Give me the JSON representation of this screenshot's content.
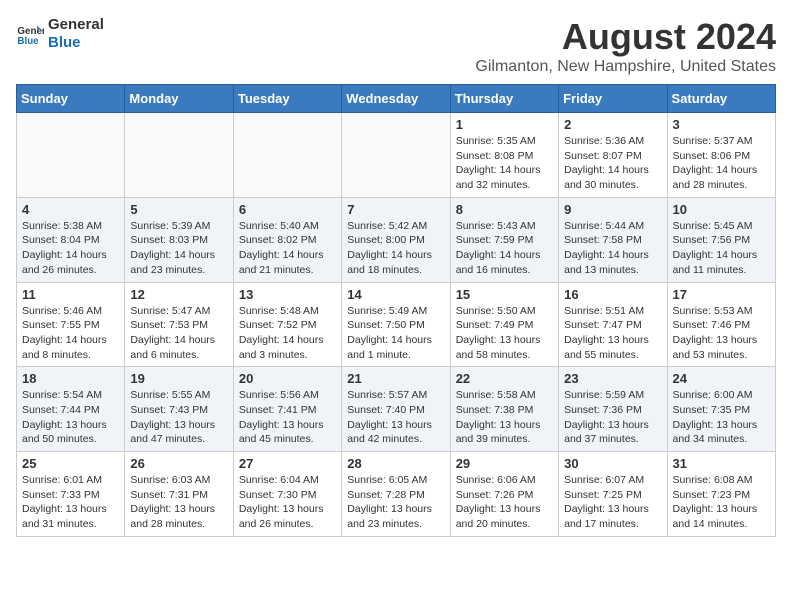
{
  "header": {
    "logo_line1": "General",
    "logo_line2": "Blue",
    "title": "August 2024",
    "subtitle": "Gilmanton, New Hampshire, United States"
  },
  "days_of_week": [
    "Sunday",
    "Monday",
    "Tuesday",
    "Wednesday",
    "Thursday",
    "Friday",
    "Saturday"
  ],
  "weeks": [
    [
      {
        "day": "",
        "info": ""
      },
      {
        "day": "",
        "info": ""
      },
      {
        "day": "",
        "info": ""
      },
      {
        "day": "",
        "info": ""
      },
      {
        "day": "1",
        "info": "Sunrise: 5:35 AM\nSunset: 8:08 PM\nDaylight: 14 hours\nand 32 minutes."
      },
      {
        "day": "2",
        "info": "Sunrise: 5:36 AM\nSunset: 8:07 PM\nDaylight: 14 hours\nand 30 minutes."
      },
      {
        "day": "3",
        "info": "Sunrise: 5:37 AM\nSunset: 8:06 PM\nDaylight: 14 hours\nand 28 minutes."
      }
    ],
    [
      {
        "day": "4",
        "info": "Sunrise: 5:38 AM\nSunset: 8:04 PM\nDaylight: 14 hours\nand 26 minutes."
      },
      {
        "day": "5",
        "info": "Sunrise: 5:39 AM\nSunset: 8:03 PM\nDaylight: 14 hours\nand 23 minutes."
      },
      {
        "day": "6",
        "info": "Sunrise: 5:40 AM\nSunset: 8:02 PM\nDaylight: 14 hours\nand 21 minutes."
      },
      {
        "day": "7",
        "info": "Sunrise: 5:42 AM\nSunset: 8:00 PM\nDaylight: 14 hours\nand 18 minutes."
      },
      {
        "day": "8",
        "info": "Sunrise: 5:43 AM\nSunset: 7:59 PM\nDaylight: 14 hours\nand 16 minutes."
      },
      {
        "day": "9",
        "info": "Sunrise: 5:44 AM\nSunset: 7:58 PM\nDaylight: 14 hours\nand 13 minutes."
      },
      {
        "day": "10",
        "info": "Sunrise: 5:45 AM\nSunset: 7:56 PM\nDaylight: 14 hours\nand 11 minutes."
      }
    ],
    [
      {
        "day": "11",
        "info": "Sunrise: 5:46 AM\nSunset: 7:55 PM\nDaylight: 14 hours\nand 8 minutes."
      },
      {
        "day": "12",
        "info": "Sunrise: 5:47 AM\nSunset: 7:53 PM\nDaylight: 14 hours\nand 6 minutes."
      },
      {
        "day": "13",
        "info": "Sunrise: 5:48 AM\nSunset: 7:52 PM\nDaylight: 14 hours\nand 3 minutes."
      },
      {
        "day": "14",
        "info": "Sunrise: 5:49 AM\nSunset: 7:50 PM\nDaylight: 14 hours\nand 1 minute."
      },
      {
        "day": "15",
        "info": "Sunrise: 5:50 AM\nSunset: 7:49 PM\nDaylight: 13 hours\nand 58 minutes."
      },
      {
        "day": "16",
        "info": "Sunrise: 5:51 AM\nSunset: 7:47 PM\nDaylight: 13 hours\nand 55 minutes."
      },
      {
        "day": "17",
        "info": "Sunrise: 5:53 AM\nSunset: 7:46 PM\nDaylight: 13 hours\nand 53 minutes."
      }
    ],
    [
      {
        "day": "18",
        "info": "Sunrise: 5:54 AM\nSunset: 7:44 PM\nDaylight: 13 hours\nand 50 minutes."
      },
      {
        "day": "19",
        "info": "Sunrise: 5:55 AM\nSunset: 7:43 PM\nDaylight: 13 hours\nand 47 minutes."
      },
      {
        "day": "20",
        "info": "Sunrise: 5:56 AM\nSunset: 7:41 PM\nDaylight: 13 hours\nand 45 minutes."
      },
      {
        "day": "21",
        "info": "Sunrise: 5:57 AM\nSunset: 7:40 PM\nDaylight: 13 hours\nand 42 minutes."
      },
      {
        "day": "22",
        "info": "Sunrise: 5:58 AM\nSunset: 7:38 PM\nDaylight: 13 hours\nand 39 minutes."
      },
      {
        "day": "23",
        "info": "Sunrise: 5:59 AM\nSunset: 7:36 PM\nDaylight: 13 hours\nand 37 minutes."
      },
      {
        "day": "24",
        "info": "Sunrise: 6:00 AM\nSunset: 7:35 PM\nDaylight: 13 hours\nand 34 minutes."
      }
    ],
    [
      {
        "day": "25",
        "info": "Sunrise: 6:01 AM\nSunset: 7:33 PM\nDaylight: 13 hours\nand 31 minutes."
      },
      {
        "day": "26",
        "info": "Sunrise: 6:03 AM\nSunset: 7:31 PM\nDaylight: 13 hours\nand 28 minutes."
      },
      {
        "day": "27",
        "info": "Sunrise: 6:04 AM\nSunset: 7:30 PM\nDaylight: 13 hours\nand 26 minutes."
      },
      {
        "day": "28",
        "info": "Sunrise: 6:05 AM\nSunset: 7:28 PM\nDaylight: 13 hours\nand 23 minutes."
      },
      {
        "day": "29",
        "info": "Sunrise: 6:06 AM\nSunset: 7:26 PM\nDaylight: 13 hours\nand 20 minutes."
      },
      {
        "day": "30",
        "info": "Sunrise: 6:07 AM\nSunset: 7:25 PM\nDaylight: 13 hours\nand 17 minutes."
      },
      {
        "day": "31",
        "info": "Sunrise: 6:08 AM\nSunset: 7:23 PM\nDaylight: 13 hours\nand 14 minutes."
      }
    ]
  ]
}
